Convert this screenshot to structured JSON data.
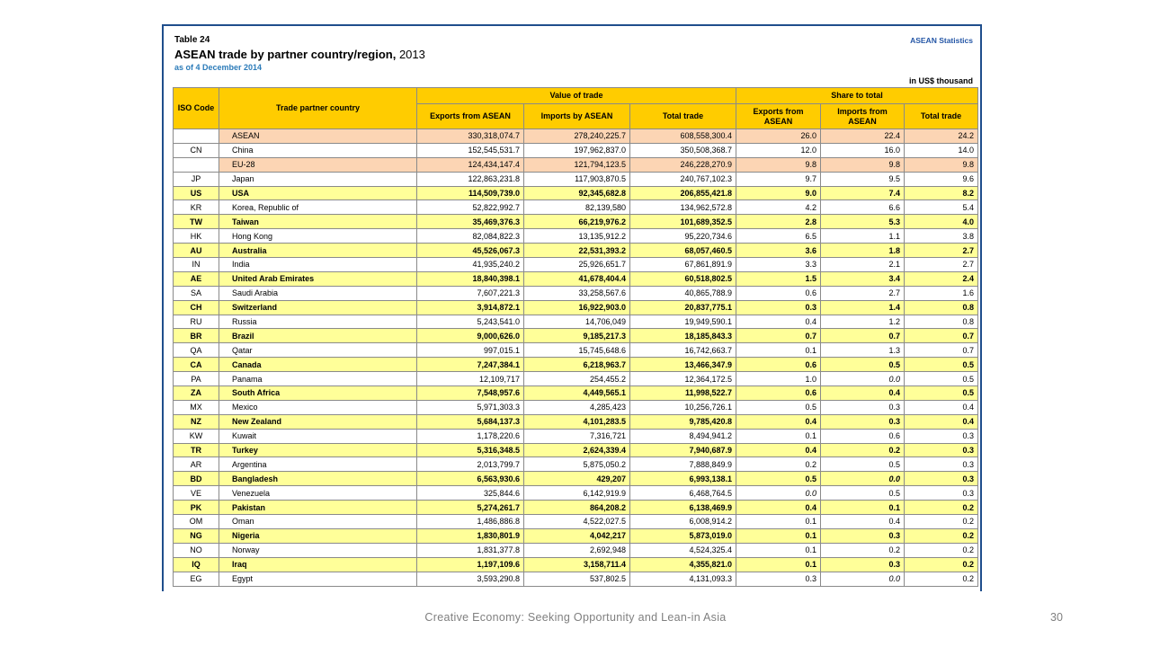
{
  "report": {
    "table_label": "Table 24",
    "title": "ASEAN trade by partner country/region,",
    "year": "2013",
    "as_of": "as of 4 December 2014",
    "source_brand": "ASEAN Statistics",
    "unit_note": "in US$ thousand"
  },
  "table": {
    "headers": {
      "iso": "ISO Code",
      "partner": "Trade partner country",
      "value_group": "Value of trade",
      "share_group": "Share to total",
      "exports": "Exports from ASEAN",
      "imports": "Imports by ASEAN",
      "total": "Total trade",
      "share_exports": "Exports from ASEAN",
      "share_imports": "Imports from ASEAN",
      "share_total": "Total trade"
    },
    "rows": [
      {
        "iso": "",
        "name": "ASEAN",
        "exports": "330,318,074.7",
        "imports": "278,240,225.7",
        "total": "608,558,300.4",
        "s_exp": "26.0",
        "s_imp": "22.4",
        "s_tot": "24.2",
        "style": "region"
      },
      {
        "iso": "CN",
        "name": "China",
        "exports": "152,545,531.7",
        "imports": "197,962,837.0",
        "total": "350,508,368.7",
        "s_exp": "12.0",
        "s_imp": "16.0",
        "s_tot": "14.0",
        "style": "plain"
      },
      {
        "iso": "",
        "name": "EU-28",
        "exports": "124,434,147.4",
        "imports": "121,794,123.5",
        "total": "246,228,270.9",
        "s_exp": "9.8",
        "s_imp": "9.8",
        "s_tot": "9.8",
        "style": "region"
      },
      {
        "iso": "JP",
        "name": "Japan",
        "exports": "122,863,231.8",
        "imports": "117,903,870.5",
        "total": "240,767,102.3",
        "s_exp": "9.7",
        "s_imp": "9.5",
        "s_tot": "9.6",
        "style": "plain"
      },
      {
        "iso": "US",
        "name": "USA",
        "exports": "114,509,739.0",
        "imports": "92,345,682.8",
        "total": "206,855,421.8",
        "s_exp": "9.0",
        "s_imp": "7.4",
        "s_tot": "8.2",
        "style": "yellow"
      },
      {
        "iso": "KR",
        "name": "Korea, Republic of",
        "exports": "52,822,992.7",
        "imports": "82,139,580",
        "total": "134,962,572.8",
        "s_exp": "4.2",
        "s_imp": "6.6",
        "s_tot": "5.4",
        "style": "plain"
      },
      {
        "iso": "TW",
        "name": "Taiwan",
        "exports": "35,469,376.3",
        "imports": "66,219,976.2",
        "total": "101,689,352.5",
        "s_exp": "2.8",
        "s_imp": "5.3",
        "s_tot": "4.0",
        "style": "yellow"
      },
      {
        "iso": "HK",
        "name": "Hong Kong",
        "exports": "82,084,822.3",
        "imports": "13,135,912.2",
        "total": "95,220,734.6",
        "s_exp": "6.5",
        "s_imp": "1.1",
        "s_tot": "3.8",
        "style": "plain"
      },
      {
        "iso": "AU",
        "name": "Australia",
        "exports": "45,526,067.3",
        "imports": "22,531,393.2",
        "total": "68,057,460.5",
        "s_exp": "3.6",
        "s_imp": "1.8",
        "s_tot": "2.7",
        "style": "yellow"
      },
      {
        "iso": "IN",
        "name": "India",
        "exports": "41,935,240.2",
        "imports": "25,926,651.7",
        "total": "67,861,891.9",
        "s_exp": "3.3",
        "s_imp": "2.1",
        "s_tot": "2.7",
        "style": "plain"
      },
      {
        "iso": "AE",
        "name": "United Arab Emirates",
        "exports": "18,840,398.1",
        "imports": "41,678,404.4",
        "total": "60,518,802.5",
        "s_exp": "1.5",
        "s_imp": "3.4",
        "s_tot": "2.4",
        "style": "yellow"
      },
      {
        "iso": "SA",
        "name": "Saudi Arabia",
        "exports": "7,607,221.3",
        "imports": "33,258,567.6",
        "total": "40,865,788.9",
        "s_exp": "0.6",
        "s_imp": "2.7",
        "s_tot": "1.6",
        "style": "plain"
      },
      {
        "iso": "CH",
        "name": "Switzerland",
        "exports": "3,914,872.1",
        "imports": "16,922,903.0",
        "total": "20,837,775.1",
        "s_exp": "0.3",
        "s_imp": "1.4",
        "s_tot": "0.8",
        "style": "yellow"
      },
      {
        "iso": "RU",
        "name": "Russia",
        "exports": "5,243,541.0",
        "imports": "14,706,049",
        "total": "19,949,590.1",
        "s_exp": "0.4",
        "s_imp": "1.2",
        "s_tot": "0.8",
        "style": "plain"
      },
      {
        "iso": "BR",
        "name": "Brazil",
        "exports": "9,000,626.0",
        "imports": "9,185,217.3",
        "total": "18,185,843.3",
        "s_exp": "0.7",
        "s_imp": "0.7",
        "s_tot": "0.7",
        "style": "yellow"
      },
      {
        "iso": "QA",
        "name": "Qatar",
        "exports": "997,015.1",
        "imports": "15,745,648.6",
        "total": "16,742,663.7",
        "s_exp": "0.1",
        "s_imp": "1.3",
        "s_tot": "0.7",
        "style": "plain"
      },
      {
        "iso": "CA",
        "name": "Canada",
        "exports": "7,247,384.1",
        "imports": "6,218,963.7",
        "total": "13,466,347.9",
        "s_exp": "0.6",
        "s_imp": "0.5",
        "s_tot": "0.5",
        "style": "yellow"
      },
      {
        "iso": "PA",
        "name": "Panama",
        "exports": "12,109,717",
        "imports": "254,455.2",
        "total": "12,364,172.5",
        "s_exp": "1.0",
        "s_imp": "0.0",
        "s_tot": "0.5",
        "style": "plain",
        "imp_italic": true
      },
      {
        "iso": "ZA",
        "name": "South Africa",
        "exports": "7,548,957.6",
        "imports": "4,449,565.1",
        "total": "11,998,522.7",
        "s_exp": "0.6",
        "s_imp": "0.4",
        "s_tot": "0.5",
        "style": "yellow"
      },
      {
        "iso": "MX",
        "name": "Mexico",
        "exports": "5,971,303.3",
        "imports": "4,285,423",
        "total": "10,256,726.1",
        "s_exp": "0.5",
        "s_imp": "0.3",
        "s_tot": "0.4",
        "style": "plain"
      },
      {
        "iso": "NZ",
        "name": "New Zealand",
        "exports": "5,684,137.3",
        "imports": "4,101,283.5",
        "total": "9,785,420.8",
        "s_exp": "0.4",
        "s_imp": "0.3",
        "s_tot": "0.4",
        "style": "yellow"
      },
      {
        "iso": "KW",
        "name": "Kuwait",
        "exports": "1,178,220.6",
        "imports": "7,316,721",
        "total": "8,494,941.2",
        "s_exp": "0.1",
        "s_imp": "0.6",
        "s_tot": "0.3",
        "style": "plain"
      },
      {
        "iso": "TR",
        "name": "Turkey",
        "exports": "5,316,348.5",
        "imports": "2,624,339.4",
        "total": "7,940,687.9",
        "s_exp": "0.4",
        "s_imp": "0.2",
        "s_tot": "0.3",
        "style": "yellow"
      },
      {
        "iso": "AR",
        "name": "Argentina",
        "exports": "2,013,799.7",
        "imports": "5,875,050.2",
        "total": "7,888,849.9",
        "s_exp": "0.2",
        "s_imp": "0.5",
        "s_tot": "0.3",
        "style": "plain"
      },
      {
        "iso": "BD",
        "name": "Bangladesh",
        "exports": "6,563,930.6",
        "imports": "429,207",
        "total": "6,993,138.1",
        "s_exp": "0.5",
        "s_imp": "0.0",
        "s_tot": "0.3",
        "style": "yellow",
        "imp_italic": true
      },
      {
        "iso": "VE",
        "name": "Venezuela",
        "exports": "325,844.6",
        "imports": "6,142,919.9",
        "total": "6,468,764.5",
        "s_exp": "0.0",
        "s_imp": "0.5",
        "s_tot": "0.3",
        "style": "plain",
        "exp_italic": true
      },
      {
        "iso": "PK",
        "name": "Pakistan",
        "exports": "5,274,261.7",
        "imports": "864,208.2",
        "total": "6,138,469.9",
        "s_exp": "0.4",
        "s_imp": "0.1",
        "s_tot": "0.2",
        "style": "yellow"
      },
      {
        "iso": "OM",
        "name": "Oman",
        "exports": "1,486,886.8",
        "imports": "4,522,027.5",
        "total": "6,008,914.2",
        "s_exp": "0.1",
        "s_imp": "0.4",
        "s_tot": "0.2",
        "style": "plain"
      },
      {
        "iso": "NG",
        "name": "Nigeria",
        "exports": "1,830,801.9",
        "imports": "4,042,217",
        "total": "5,873,019.0",
        "s_exp": "0.1",
        "s_imp": "0.3",
        "s_tot": "0.2",
        "style": "yellow"
      },
      {
        "iso": "NO",
        "name": "Norway",
        "exports": "1,831,377.8",
        "imports": "2,692,948",
        "total": "4,524,325.4",
        "s_exp": "0.1",
        "s_imp": "0.2",
        "s_tot": "0.2",
        "style": "plain"
      },
      {
        "iso": "IQ",
        "name": "Iraq",
        "exports": "1,197,109.6",
        "imports": "3,158,711.4",
        "total": "4,355,821.0",
        "s_exp": "0.1",
        "s_imp": "0.3",
        "s_tot": "0.2",
        "style": "yellow"
      },
      {
        "iso": "EG",
        "name": "Egypt",
        "exports": "3,593,290.8",
        "imports": "537,802.5",
        "total": "4,131,093.3",
        "s_exp": "0.3",
        "s_imp": "0.0",
        "s_tot": "0.2",
        "style": "plain",
        "imp_italic": true
      }
    ]
  },
  "footer": {
    "text": "Creative Economy: Seeking Opportunity and Lean-in Asia",
    "page_number": "30"
  },
  "colors": {
    "header_fill": "#ffcc00",
    "region_row_fill": "#fcd5b4",
    "highlight_row_fill": "#ffff99",
    "as_of_text": "#2b7bb9",
    "brand_text": "#2456a6"
  }
}
